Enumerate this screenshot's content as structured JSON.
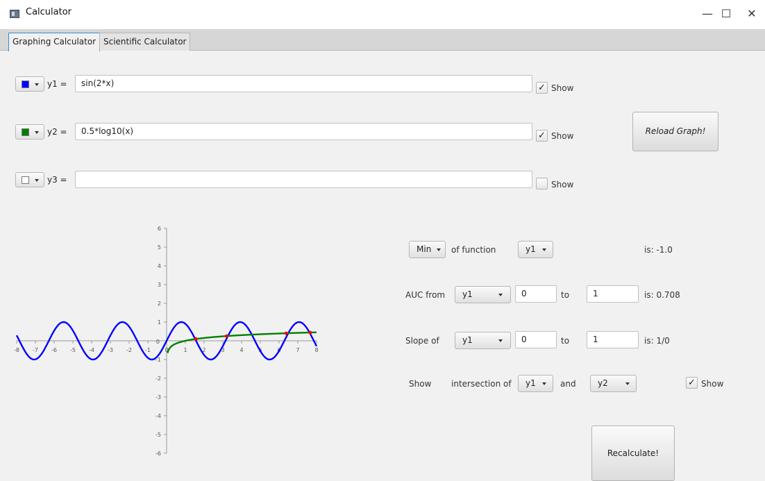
{
  "window": {
    "title": "Calculator",
    "minimize": "—",
    "maximize": "☐",
    "close": "✕"
  },
  "tabs": [
    {
      "label": "Graphing Calculator",
      "active": true
    },
    {
      "label": "Scientific Calculator",
      "active": false
    }
  ],
  "functions": [
    {
      "label": "y1 =",
      "expression": "sin(2*x)",
      "color": "#0000ff",
      "show_label": "Show",
      "show_checked": true
    },
    {
      "label": "y2 =",
      "expression": "0.5*log10(x)",
      "color": "#008000",
      "show_label": "Show",
      "show_checked": true
    },
    {
      "label": "y3 =",
      "expression": "",
      "color": "#ffffff",
      "show_label": "Show",
      "show_checked": false
    }
  ],
  "reload_button": "Reload Graph!",
  "analysis": {
    "min_row": {
      "mode": "Min",
      "of_function_label": "of function",
      "function": "y1",
      "result": "is: -1.0"
    },
    "auc_row": {
      "label": "AUC from",
      "function": "y1",
      "from": "0",
      "to_label": "to",
      "to": "1",
      "result": "is: 0.708"
    },
    "slope_row": {
      "label": "Slope of",
      "function": "y1",
      "from": "0",
      "to_label": "to",
      "to": "1",
      "result": "is: 1/0"
    },
    "intersection_row": {
      "show_label": "Show",
      "intersection_label": "intersection of",
      "function_a": "y1",
      "and_label": "and",
      "function_b": "y2",
      "checkbox_label": "Show",
      "checked": true
    }
  },
  "recalculate_button": "Recalculate!",
  "chart_data": {
    "type": "line",
    "xlim": [
      -8,
      8
    ],
    "ylim": [
      -6,
      6
    ],
    "x_ticks": [
      -8,
      -7,
      -6,
      -5,
      -4,
      -3,
      -2,
      -1,
      0,
      1,
      2,
      3,
      4,
      5,
      6,
      7,
      8
    ],
    "y_ticks": [
      -6,
      -5,
      -4,
      -3,
      -2,
      -1,
      0,
      1,
      2,
      3,
      4,
      5,
      6
    ],
    "grid": false,
    "series": [
      {
        "name": "y1",
        "expression": "sin(2*x)",
        "color": "#0000ff",
        "x_range": [
          -8,
          8
        ],
        "samples": 321
      },
      {
        "name": "y2",
        "expression": "0.5*log10(x)",
        "color": "#008000",
        "x_range": [
          0.05,
          8
        ],
        "samples": 200
      }
    ],
    "intersection_points": [
      {
        "x": 1.56,
        "y": 0.1
      },
      {
        "x": 3.2,
        "y": 0.25
      },
      {
        "x": 6.38,
        "y": 0.4
      },
      {
        "x": 7.66,
        "y": 0.44
      }
    ],
    "intersection_color": "#ff0000"
  }
}
